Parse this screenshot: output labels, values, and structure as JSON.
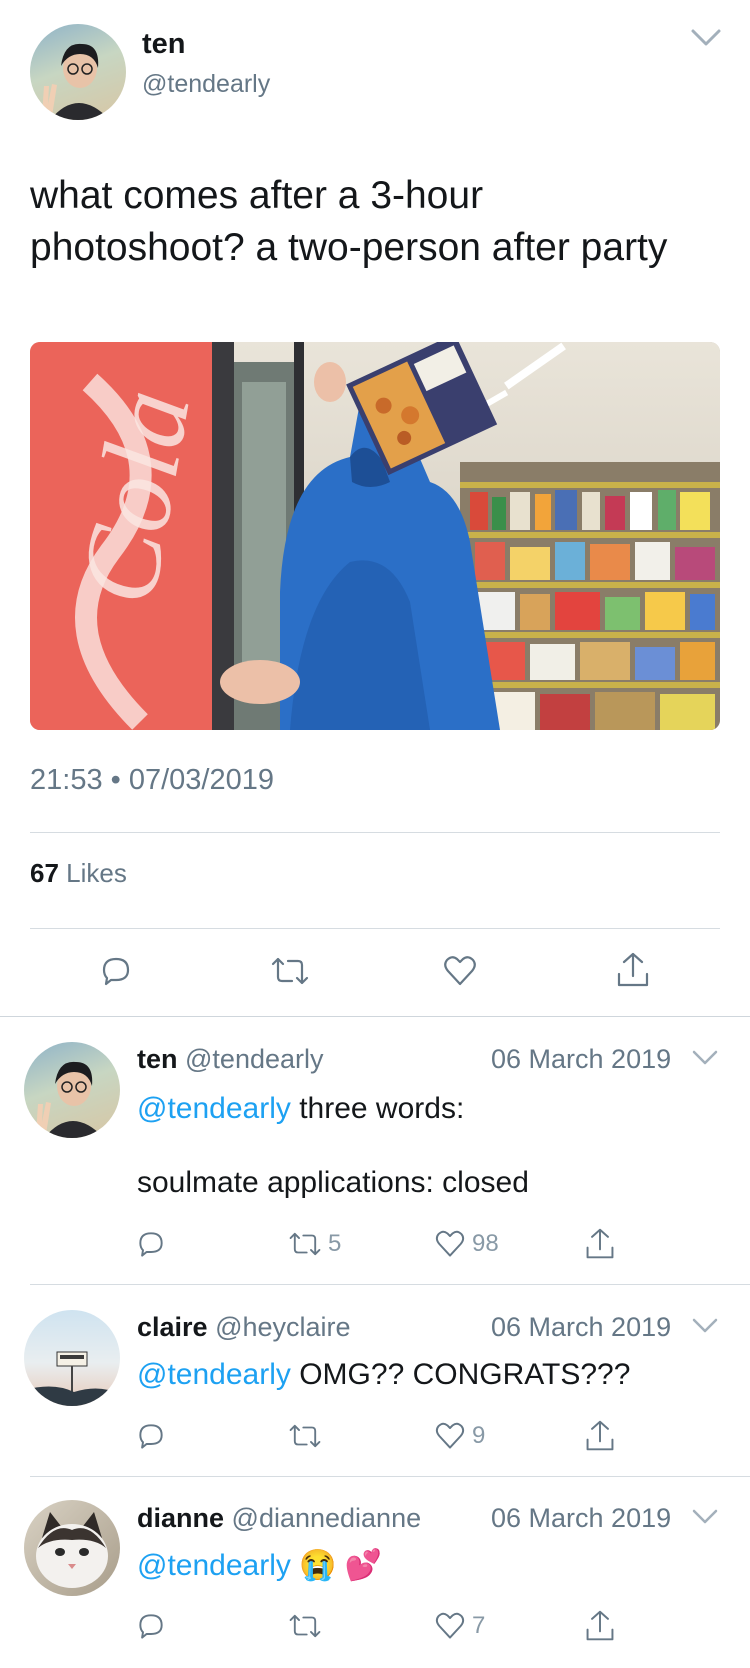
{
  "main_tweet": {
    "author_name": "ten",
    "author_handle": "@tendearly",
    "text": "what comes after a 3-hour photoshoot? a two-person after party",
    "timestamp": "21:53 • 07/03/2019",
    "likes_count": "67",
    "likes_label": "Likes",
    "avatar": "person-peace-sign",
    "photo": "convenience-store-hoodie-cereal-box"
  },
  "replies": [
    {
      "name": "ten",
      "handle": "@tendearly",
      "date": "06 March 2019",
      "mention": "@tendearly",
      "text_line1": "three words:",
      "text_line2": "soulmate applications: closed",
      "retweets": "5",
      "likes": "98",
      "avatar": "person-peace-sign"
    },
    {
      "name": "claire",
      "handle": "@heyclaire",
      "date": "06 March 2019",
      "mention": "@tendearly",
      "text": "OMG?? CONGRATS???",
      "retweets": "",
      "likes": "9",
      "avatar": "street-sign"
    },
    {
      "name": "dianne",
      "handle": "@diannedianne",
      "date": "06 March 2019",
      "mention": "@tendearly",
      "text": "😭 💕",
      "retweets": "",
      "likes": "7",
      "avatar": "cat"
    }
  ],
  "colors": {
    "accent": "#1da1f2",
    "secondary_text": "#657786",
    "divider": "#d6dce1"
  }
}
